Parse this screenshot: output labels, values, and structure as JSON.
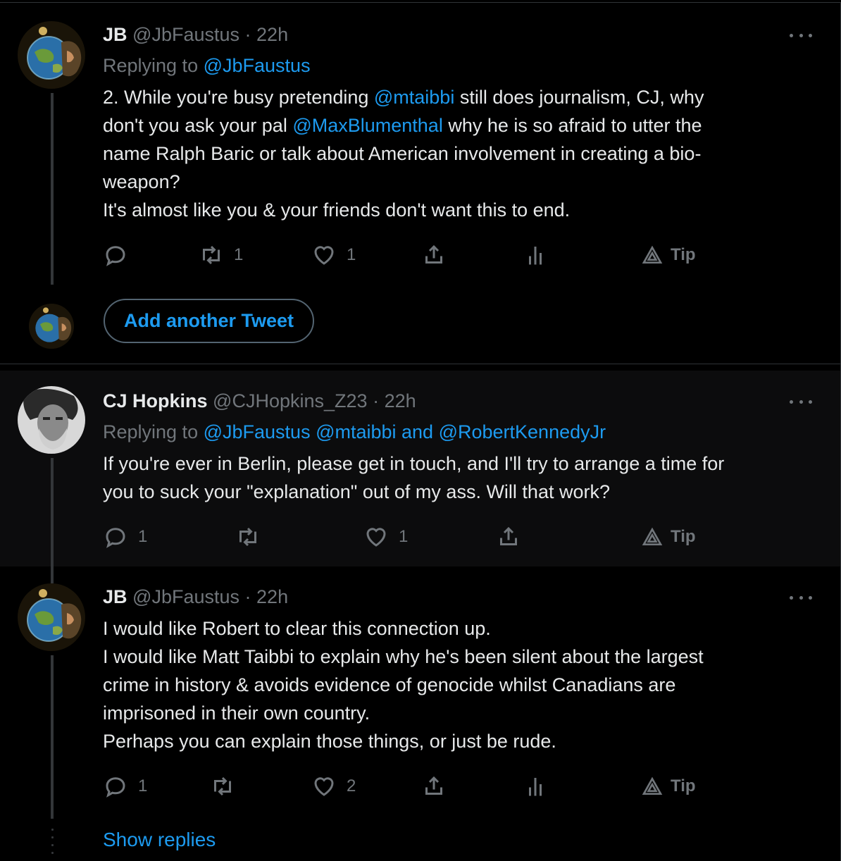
{
  "tweets": [
    {
      "name": "JB",
      "handle": "@JbFaustus",
      "dot": "·",
      "time": "22h",
      "replying_prefix": "Replying to",
      "replying_to": "@JbFaustus",
      "body_lines": [
        [
          {
            "t": "2. While you're busy pretending "
          },
          {
            "t": "@mtaibbi",
            "link": true
          },
          {
            "t": " still does journalism, CJ, why"
          }
        ],
        [
          {
            "t": "don't you ask your pal "
          },
          {
            "t": "@MaxBlumenthal",
            "link": true
          },
          {
            "t": " why he is so afraid to utter the"
          }
        ],
        [
          {
            "t": "name Ralph Baric or talk about American involvement in creating a bio-"
          }
        ],
        [
          {
            "t": "weapon?"
          }
        ],
        [
          {
            "t": "It's almost like you & your friends don't want this to end."
          }
        ]
      ],
      "reply_count": "",
      "retweet_count": "1",
      "like_count": "1",
      "tip_label": "Tip"
    },
    {
      "name": "CJ Hopkins",
      "handle": "@CJHopkins_Z23",
      "dot": "·",
      "time": "22h",
      "replying_prefix": "Replying to",
      "replying_to": "@JbFaustus @mtaibbi and @RobertKennedyJr",
      "body_lines": [
        [
          {
            "t": "If you're ever in Berlin, please get in touch, and I'll try to arrange a time for"
          }
        ],
        [
          {
            "t": "you to suck your \"explanation\" out of my ass. Will that work?"
          }
        ]
      ],
      "reply_count": "1",
      "retweet_count": "",
      "like_count": "1",
      "tip_label": "Tip"
    },
    {
      "name": "JB",
      "handle": "@JbFaustus",
      "dot": "·",
      "time": "22h",
      "body_lines": [
        [
          {
            "t": "I would like Robert to clear this connection up."
          }
        ],
        [
          {
            "t": "I would like Matt Taibbi to explain why he's been silent about the largest"
          }
        ],
        [
          {
            "t": "crime in history & avoids evidence of genocide whilst Canadians are"
          }
        ],
        [
          {
            "t": "imprisoned in their own country."
          }
        ],
        [
          {
            "t": "Perhaps you can explain those things, or just be rude."
          }
        ]
      ],
      "reply_count": "1",
      "retweet_count": "",
      "like_count": "2",
      "tip_label": "Tip"
    }
  ],
  "compose": {
    "add_another_label": "Add another Tweet"
  },
  "show_replies_label": "Show replies",
  "colors": {
    "background": "#000000",
    "highlight_bg": "#0c0c0d",
    "link": "#1d9bf0",
    "muted": "#71767b",
    "text": "#e7e9ea"
  },
  "icons": {
    "reply": "reply-icon",
    "retweet": "retweet-icon",
    "like": "heart-icon",
    "share": "share-icon",
    "analytics": "analytics-icon",
    "tip": "tip-icon",
    "more": "more-icon"
  }
}
